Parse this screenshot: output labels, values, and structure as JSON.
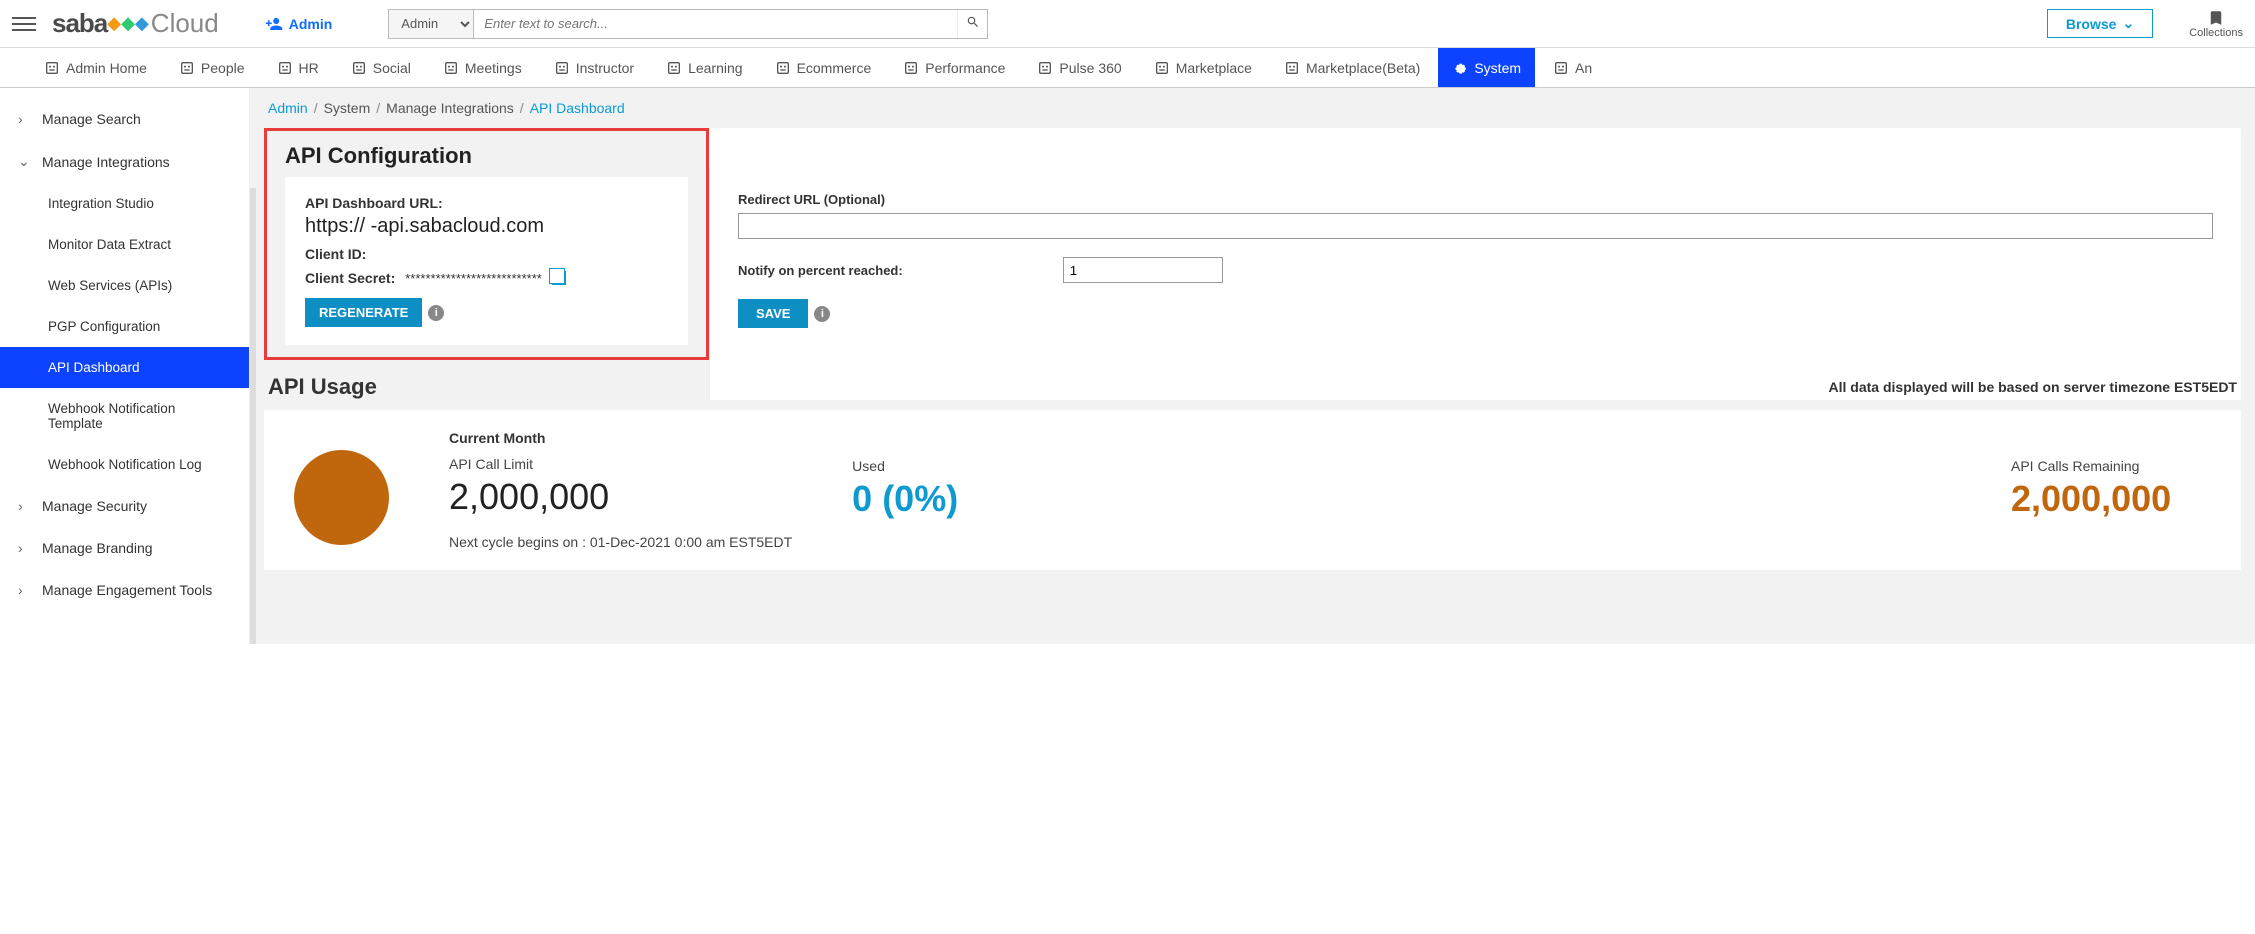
{
  "header": {
    "logo_brand": "saba",
    "logo_suffix": "Cloud",
    "user_label": "Admin",
    "search_scope": "Admin",
    "search_placeholder": "Enter text to search...",
    "browse_label": "Browse",
    "collections_label": "Collections"
  },
  "navtabs": [
    {
      "label": "Admin Home",
      "active": false
    },
    {
      "label": "People",
      "active": false
    },
    {
      "label": "HR",
      "active": false
    },
    {
      "label": "Social",
      "active": false
    },
    {
      "label": "Meetings",
      "active": false
    },
    {
      "label": "Instructor",
      "active": false
    },
    {
      "label": "Learning",
      "active": false
    },
    {
      "label": "Ecommerce",
      "active": false
    },
    {
      "label": "Performance",
      "active": false
    },
    {
      "label": "Pulse 360",
      "active": false
    },
    {
      "label": "Marketplace",
      "active": false
    },
    {
      "label": "Marketplace(Beta)",
      "active": false
    },
    {
      "label": "System",
      "active": true
    },
    {
      "label": "An",
      "active": false
    }
  ],
  "breadcrumb": [
    {
      "label": "Admin",
      "link": true
    },
    {
      "label": "System",
      "link": false
    },
    {
      "label": "Manage Integrations",
      "link": false
    },
    {
      "label": "API Dashboard",
      "link": true
    }
  ],
  "sidebar": [
    {
      "label": "Manage Search",
      "type": "group",
      "expanded": false
    },
    {
      "label": "Manage Integrations",
      "type": "group",
      "expanded": true
    },
    {
      "label": "Integration Studio",
      "type": "sub"
    },
    {
      "label": "Monitor Data Extract",
      "type": "sub"
    },
    {
      "label": "Web Services (APIs)",
      "type": "sub"
    },
    {
      "label": "PGP Configuration",
      "type": "sub"
    },
    {
      "label": "API Dashboard",
      "type": "sub",
      "active": true
    },
    {
      "label": "Webhook Notification Template",
      "type": "sub"
    },
    {
      "label": "Webhook Notification Log",
      "type": "sub"
    },
    {
      "label": "Manage Security",
      "type": "group",
      "expanded": false
    },
    {
      "label": "Manage Branding",
      "type": "group",
      "expanded": false
    },
    {
      "label": "Manage Engagement Tools",
      "type": "group",
      "expanded": false
    }
  ],
  "api_config": {
    "title": "API Configuration",
    "url_label": "API Dashboard URL:",
    "url_value": "https://        -api.sabacloud.com",
    "client_id_label": "Client ID:",
    "client_secret_label": "Client Secret:",
    "client_secret_value": "***************************",
    "regenerate_label": "REGENERATE",
    "redirect_label": "Redirect URL (Optional)",
    "redirect_value": "",
    "notify_label": "Notify on percent reached:",
    "notify_value": "1",
    "save_label": "SAVE"
  },
  "api_usage": {
    "title": "API Usage",
    "tz_note": "All data displayed will be based on server timezone EST5EDT",
    "current_month_label": "Current Month",
    "limit_label": "API Call Limit",
    "limit_value": "2,000,000",
    "used_label": "Used",
    "used_value": "0 (0%)",
    "remaining_label": "API Calls Remaining",
    "remaining_value": "2,000,000",
    "next_cycle": "Next cycle begins on : 01-Dec-2021 0:00 am EST5EDT"
  }
}
